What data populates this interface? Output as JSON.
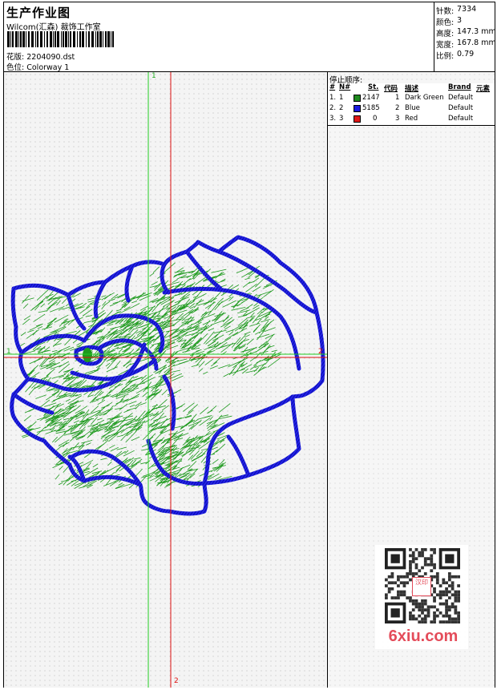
{
  "header": {
    "title": "生产作业图",
    "company": "Wilcom(汇森) 裁饰工作室",
    "design_label": "花版:",
    "design_value": "2204090.dst",
    "colorway_label": "色位:",
    "colorway_value": "Colorway 1"
  },
  "stats": [
    {
      "label": "针数:",
      "value": "7334"
    },
    {
      "label": "颜色:",
      "value": "3"
    },
    {
      "label": "高度:",
      "value": "147.3 mm"
    },
    {
      "label": "宽度:",
      "value": "167.8 mm"
    },
    {
      "label": "比例:",
      "value": "0.79"
    }
  ],
  "stop_sequence": {
    "title": "停止顺序:",
    "columns": [
      "#",
      "N#",
      "St.",
      "代码",
      "描述",
      "Brand",
      "元素"
    ],
    "rows": [
      {
        "num": "1.",
        "n": "1",
        "color": "#1f8a1f",
        "stitches": "2147",
        "code": "1",
        "desc": "Dark Green",
        "brand": "Default"
      },
      {
        "num": "2.",
        "n": "2",
        "color": "#1a1adf",
        "stitches": "5185",
        "code": "2",
        "desc": "Blue",
        "brand": "Default"
      },
      {
        "num": "3.",
        "n": "3",
        "color": "#e01818",
        "stitches": "0",
        "code": "3",
        "desc": "Red",
        "brand": "Default"
      }
    ]
  },
  "guides": {
    "green_label": "1",
    "red_label": "2",
    "green_color": "#22cc22",
    "red_color": "#dd1111"
  },
  "watermark": {
    "text": "6xiu.com",
    "stamp": "汉印",
    "color": "#e44c5a"
  }
}
